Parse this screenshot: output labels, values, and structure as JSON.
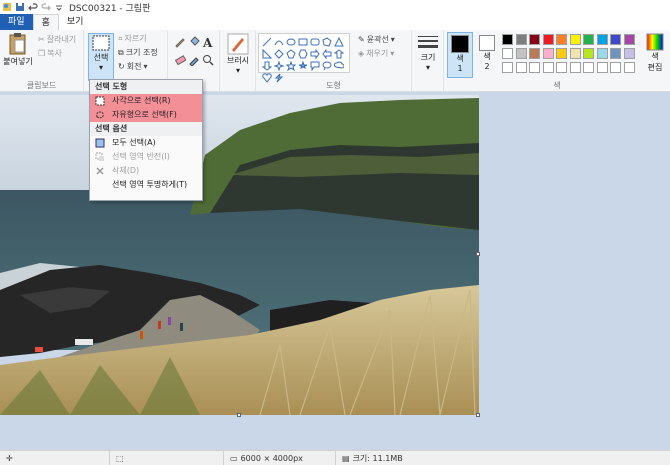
{
  "window": {
    "title": "DSC00321 - 그림판"
  },
  "tabs": [
    {
      "label": "파일"
    },
    {
      "label": "홈"
    },
    {
      "label": "보기"
    }
  ],
  "ribbon": {
    "clipboard": {
      "paste": "붙여넣기",
      "cut": "잘라내기",
      "copy": "복사",
      "label": "클립보드"
    },
    "image": {
      "select": "선택",
      "crop": "자르기",
      "resize": "크기 조정",
      "rotate": "회전"
    },
    "tools": {
      "label": ""
    },
    "brushes": {
      "label": "브러시"
    },
    "shapes": {
      "outline": "윤곽선",
      "fill": "채우기",
      "label": "도형"
    },
    "size": {
      "label": "크기"
    },
    "colors": {
      "color1": "색",
      "color1_num": "1",
      "color2": "색",
      "color2_num": "2",
      "edit": "색 편집",
      "label": "색"
    }
  },
  "menu": {
    "heading1": "선택 도형",
    "rect_select": "사각으로 선택(R)",
    "free_select": "자유형으로 선택(F)",
    "heading2": "선택 옵션",
    "select_all": "모두 선택(A)",
    "invert": "선택 영역 반전(I)",
    "delete": "삭제(D)",
    "transparent": "선택 영역 투명하게(T)"
  },
  "palette": {
    "row1": [
      "#000000",
      "#7f7f7f",
      "#880015",
      "#ed1c24",
      "#ff7f27",
      "#fff200",
      "#22b14c",
      "#00a2e8",
      "#3f48cc",
      "#a349a4"
    ],
    "row2": [
      "#ffffff",
      "#c3c3c3",
      "#b97a57",
      "#ffaec9",
      "#ffc90e",
      "#efe4b0",
      "#b5e61d",
      "#99d9ea",
      "#7092be",
      "#c8bfe7"
    ]
  },
  "status": {
    "dimensions": "6000 × 4000px",
    "filesize": "크기: 11.1MB"
  }
}
